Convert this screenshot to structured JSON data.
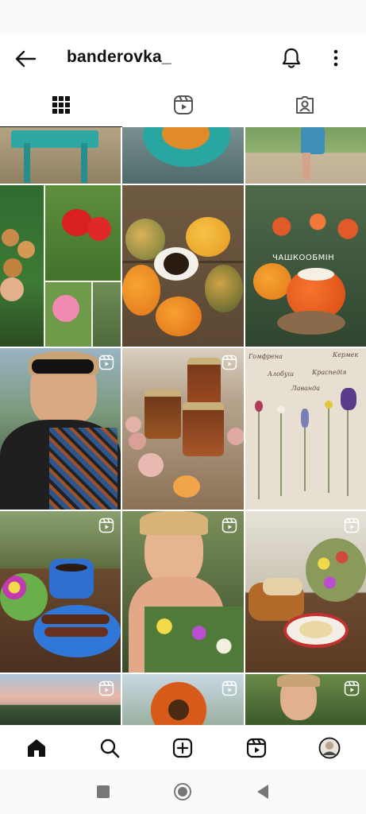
{
  "header": {
    "username": "banderovka_"
  },
  "tabs": [
    {
      "name": "posts-grid",
      "icon": "grid-icon",
      "active": true
    },
    {
      "name": "reels",
      "icon": "reels-icon",
      "active": false
    },
    {
      "name": "tagged",
      "icon": "tagged-icon",
      "active": false
    }
  ],
  "grid": {
    "overlay_texts": {
      "autumn_tea": "ЧАШКООБМІН",
      "flowers": [
        "Гомфрена",
        "Кермек",
        "Алобуш",
        "Краспедія",
        "Лаванда"
      ]
    }
  },
  "bottom_nav": [
    "home-icon",
    "search-icon",
    "create-icon",
    "reels-icon",
    "profile-avatar"
  ],
  "system_nav": [
    "recent-apps-icon",
    "home-circle-icon",
    "back-triangle-icon"
  ],
  "colors": {
    "text": "#111111",
    "divider": "#dddddd",
    "background": "#ffffff"
  }
}
